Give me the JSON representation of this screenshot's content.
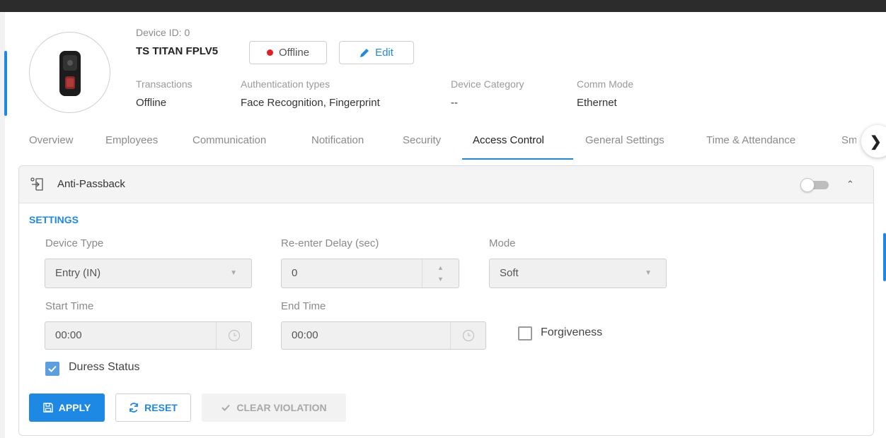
{
  "device": {
    "id_label": "Device ID: 0",
    "name": "TS TITAN FPLV5",
    "status_button": "Offline",
    "edit_button": "Edit"
  },
  "info": [
    {
      "label": "Transactions",
      "value": "Offline"
    },
    {
      "label": "Authentication types",
      "value": "Face Recognition, Fingerprint"
    },
    {
      "label": "Device Category",
      "value": "--"
    },
    {
      "label": "Comm Mode",
      "value": "Ethernet"
    }
  ],
  "tabs": [
    "Overview",
    "Employees",
    "Communication",
    "Notification",
    "Security",
    "Access Control",
    "General Settings",
    "Time & Attendance",
    "Sm"
  ],
  "active_tab": "Access Control",
  "panel": {
    "title": "Anti-Passback",
    "enabled": false,
    "section_title": "SETTINGS",
    "device_type": {
      "label": "Device Type",
      "value": "Entry (IN)"
    },
    "reenter_delay": {
      "label": "Re-enter Delay (sec)",
      "value": "0"
    },
    "mode": {
      "label": "Mode",
      "value": "Soft"
    },
    "start_time": {
      "label": "Start Time",
      "value": "00:00"
    },
    "end_time": {
      "label": "End Time",
      "value": "00:00"
    },
    "forgiveness": {
      "label": "Forgiveness",
      "checked": false
    },
    "duress": {
      "label": "Duress Status",
      "checked": true
    }
  },
  "actions": {
    "apply": "APPLY",
    "reset": "RESET",
    "clear": "CLEAR VIOLATION"
  },
  "colors": {
    "accent": "#1e88e5",
    "offline_dot": "#e02020"
  }
}
